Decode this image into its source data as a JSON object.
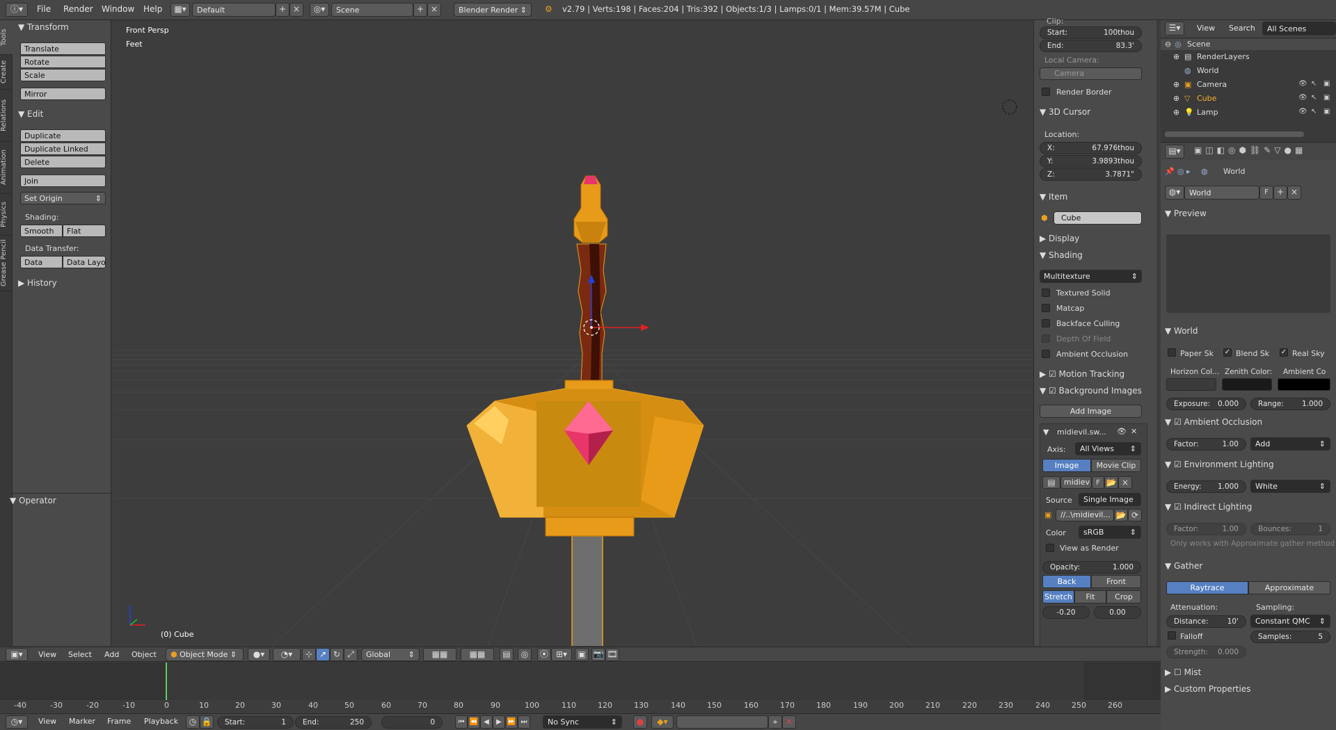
{
  "topbar": {
    "menus": [
      "File",
      "Render",
      "Window",
      "Help"
    ],
    "screen_layout": "Default",
    "scene": "Scene",
    "render_engine": "Blender Render",
    "status": "v2.79 | Verts:198 | Faces:204 | Tris:392 | Objects:1/3 | Lamps:0/1 | Mem:39.57M | Cube"
  },
  "toolshelf_tabs": [
    "Tools",
    "Create",
    "Relations",
    "Animation",
    "Physics",
    "Grease Pencil"
  ],
  "tools": {
    "transform_header": "Transform",
    "translate": "Translate",
    "rotate": "Rotate",
    "scale": "Scale",
    "mirror": "Mirror",
    "edit_header": "Edit",
    "duplicate": "Duplicate",
    "duplicate_linked": "Duplicate Linked",
    "delete": "Delete",
    "join": "Join",
    "set_origin": "Set Origin",
    "shading_label": "Shading:",
    "smooth": "Smooth",
    "flat": "Flat",
    "data_transfer_label": "Data Transfer:",
    "data": "Data",
    "data_layout": "Data Layo",
    "history_header": "History",
    "operator_header": "Operator"
  },
  "viewport": {
    "view_name": "Front Persp",
    "units": "Feet",
    "active_object": "(0) Cube"
  },
  "npanel": {
    "clip_label": "Clip:",
    "clip_start_label": "Start:",
    "clip_start": "100thou",
    "clip_end_label": "End:",
    "clip_end": "83.3'",
    "local_camera_label": "Local Camera:",
    "camera": "Camera",
    "render_border": "Render Border",
    "cursor_header": "3D Cursor",
    "location_label": "Location:",
    "x_label": "X:",
    "x": "67.976thou",
    "y_label": "Y:",
    "y": "3.9893thou",
    "z_label": "Z:",
    "z": "3.7871\"",
    "item_header": "Item",
    "item_name": "Cube",
    "display_header": "Display",
    "shading_header": "Shading",
    "shading_mode": "Multitexture",
    "textured_solid": "Textured Solid",
    "matcap": "Matcap",
    "backface_culling": "Backface Culling",
    "depth_of_field": "Depth Of Field",
    "ambient_occlusion": "Ambient Occlusion",
    "motion_tracking": "Motion Tracking",
    "background_images": "Background Images",
    "add_image": "Add Image",
    "bg_image_name": "midievil.sw...",
    "axis_label": "Axis:",
    "axis_value": "All Views",
    "image_tab": "Image",
    "movie_clip_tab": "Movie Clip",
    "image_datablock": "midiev",
    "image_f": "F",
    "source_label": "Source",
    "source_value": "Single Image",
    "filepath": "//..\\midievil...",
    "color_label": "Color",
    "color_value": "sRGB",
    "view_as_render": "View as Render",
    "opacity_label": "Opacity:",
    "opacity": "1.000",
    "back": "Back",
    "front": "Front",
    "stretch": "Stretch",
    "fit": "Fit",
    "crop": "Crop",
    "offset_x": "-0.20",
    "offset_y": "0.00"
  },
  "outliner": {
    "view": "View",
    "search": "Search",
    "filter": "All Scenes",
    "items": [
      "Scene",
      "RenderLayers",
      "World",
      "Camera",
      "Cube",
      "Lamp"
    ]
  },
  "properties": {
    "breadcrumb": "World",
    "world_name": "World",
    "world_f": "F",
    "preview_header": "Preview",
    "world_header": "World",
    "paper_sky": "Paper Sk",
    "blend_sky": "Blend Sk",
    "real_sky": "Real Sky",
    "horizon_label": "Horizon Col...",
    "zenith_label": "Zenith Color:",
    "ambient_label": "Ambient Co",
    "exposure_label": "Exposure:",
    "exposure": "0.000",
    "range_label": "Range:",
    "range": "1.000",
    "ao_header": "Ambient Occlusion",
    "ao_factor_label": "Factor:",
    "ao_factor": "1.00",
    "ao_blend": "Add",
    "env_header": "Environment Lighting",
    "energy_label": "Energy:",
    "energy": "1.000",
    "env_color": "White",
    "indirect_header": "Indirect Lighting",
    "indirect_factor_label": "Factor:",
    "indirect_factor": "1.00",
    "bounces_label": "Bounces:",
    "bounces": "1",
    "approx_note": "Only works with Approximate gather method",
    "gather_header": "Gather",
    "raytrace": "Raytrace",
    "approximate": "Approximate",
    "attenuation_label": "Attenuation:",
    "sampling_label": "Sampling:",
    "distance_label": "Distance:",
    "distance": "10'",
    "sampling_method": "Constant QMC",
    "falloff": "Falloff",
    "samples_label": "Samples:",
    "samples": "5",
    "strength_label": "Strength:",
    "strength": "0.000",
    "mist_header": "Mist",
    "custom_props_header": "Custom Properties"
  },
  "view3d_header": {
    "view": "View",
    "select": "Select",
    "add": "Add",
    "object": "Object",
    "mode": "Object Mode",
    "orientation": "Global"
  },
  "timeline": {
    "ruler": [
      "-40",
      "-30",
      "-20",
      "-10",
      "0",
      "10",
      "20",
      "30",
      "40",
      "50",
      "60",
      "70",
      "80",
      "90",
      "100",
      "110",
      "120",
      "130",
      "140",
      "150",
      "160",
      "170",
      "180",
      "190",
      "200",
      "210",
      "220",
      "230",
      "240",
      "250",
      "260"
    ],
    "view": "View",
    "marker": "Marker",
    "frame": "Frame",
    "playback": "Playback",
    "start_label": "Start:",
    "start": "1",
    "end_label": "End:",
    "end": "250",
    "current": "0",
    "sync": "No Sync"
  },
  "colors": {
    "accent_blue": "#5680c2",
    "sword_gold": "#e8a020",
    "gem_red": "#e8356a",
    "handle_brown": "#7a2a10"
  }
}
